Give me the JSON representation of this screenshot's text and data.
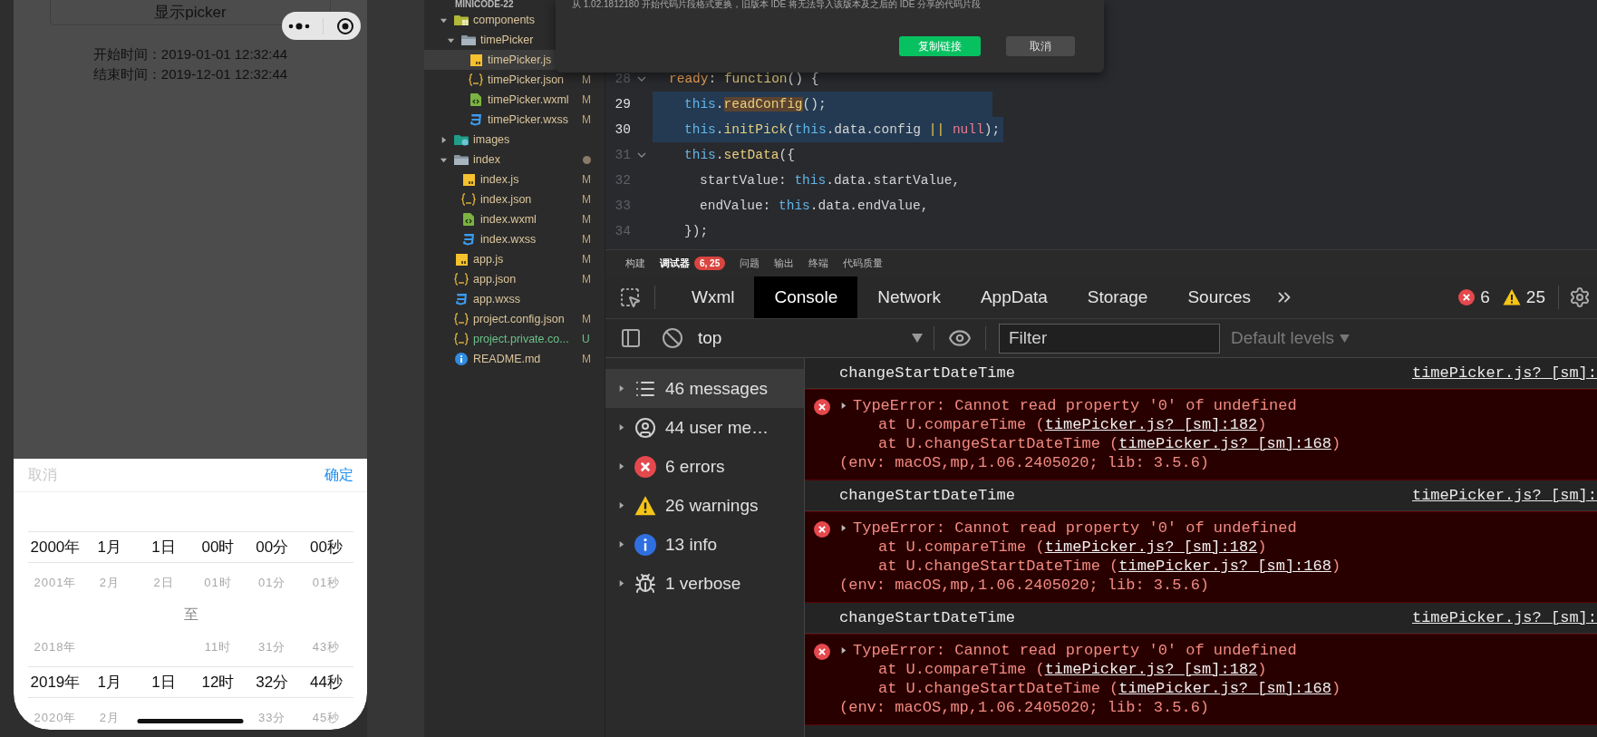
{
  "simulator": {
    "show_button": "显示picker",
    "times": [
      {
        "label": "开始时间：",
        "value": "2019-01-01 12:32:44"
      },
      {
        "label": "结束时间：",
        "value": "2019-12-01 12:32:44"
      }
    ],
    "picker": {
      "cancel": "取消",
      "confirm": "确定",
      "rows": [
        {
          "kind": "selected",
          "cells": [
            "2000年",
            "1月",
            "1日",
            "00时",
            "00分",
            "00秒"
          ]
        },
        {
          "kind": "dim",
          "cells": [
            "2001年",
            "2月",
            "2日",
            "01时",
            "01分",
            "01秒"
          ]
        },
        {
          "kind": "separator",
          "text": "至"
        },
        {
          "kind": "dim",
          "cells": [
            "2018年",
            null,
            null,
            "11时",
            "31分",
            "43秒"
          ]
        },
        {
          "kind": "selected",
          "cells": [
            "2019年",
            "1月",
            "1日",
            "12时",
            "32分",
            "44秒"
          ]
        },
        {
          "kind": "dim",
          "cells": [
            "2020年",
            "2月",
            null,
            null,
            "33分",
            "45秒"
          ]
        }
      ]
    }
  },
  "explorer": {
    "project": "MINICODE-22",
    "items": [
      {
        "name": "components",
        "kind": "folder-components",
        "expanded": true,
        "selected": false,
        "children": [
          {
            "name": "timePicker",
            "kind": "folder",
            "expanded": true,
            "selected": false,
            "children": [
              {
                "name": "timePicker.js",
                "kind": "js",
                "selected": true
              },
              {
                "name": "timePicker.json",
                "kind": "json",
                "status": "M",
                "selected": false
              },
              {
                "name": "timePicker.wxml",
                "kind": "wxml",
                "status": "M",
                "selected": false
              },
              {
                "name": "timePicker.wxss",
                "kind": "wxss",
                "status": "M",
                "selected": false
              }
            ]
          }
        ]
      },
      {
        "name": "images",
        "kind": "folder-images",
        "expanded": false,
        "selected": false
      },
      {
        "name": "index",
        "kind": "folder",
        "expanded": true,
        "selected": false,
        "dot": true,
        "children": [
          {
            "name": "index.js",
            "kind": "js",
            "status": "M",
            "selected": false
          },
          {
            "name": "index.json",
            "kind": "json",
            "status": "M",
            "selected": false
          },
          {
            "name": "index.wxml",
            "kind": "wxml",
            "status": "M",
            "selected": false
          },
          {
            "name": "index.wxss",
            "kind": "wxss",
            "status": "M",
            "selected": false
          }
        ]
      },
      {
        "name": "app.js",
        "kind": "js",
        "status": "M",
        "selected": false
      },
      {
        "name": "app.json",
        "kind": "json",
        "status": "M",
        "selected": false
      },
      {
        "name": "app.wxss",
        "kind": "wxss",
        "selected": false
      },
      {
        "name": "project.config.json",
        "kind": "json",
        "status": "M",
        "selected": false
      },
      {
        "name": "project.private.co...",
        "kind": "json",
        "status": "U",
        "selected": false
      },
      {
        "name": "README.md",
        "kind": "info",
        "status": "M",
        "selected": false
      }
    ]
  },
  "dialog": {
    "message": "从 1.02.1812180 开始代码片段格式更换，旧版本 IDE 将无法导入该版本及之后的 IDE 分享的代码片段",
    "buttons": [
      {
        "label": "复制链接",
        "kind": "primary"
      },
      {
        "label": "取消",
        "kind": "secondary"
      }
    ]
  },
  "editor": {
    "lines": [
      {
        "number": "28",
        "foldable": true,
        "highlighted": false,
        "tokens": [
          {
            "text": "ready",
            "kind": "key"
          },
          {
            "text": ": ",
            "kind": "punct"
          },
          {
            "text": "function",
            "kind": "fn"
          },
          {
            "text": "() {",
            "kind": "punct"
          }
        ],
        "children": [
          {
            "number": "29",
            "highlighted": true,
            "tokens": [
              {
                "text": "this",
                "kind": "kw"
              },
              {
                "text": ".",
                "kind": "punct"
              },
              {
                "text": "readConfig",
                "kind": "method",
                "match": true
              },
              {
                "text": "();",
                "kind": "punct"
              }
            ]
          },
          {
            "number": "30",
            "highlighted": true,
            "tokens": [
              {
                "text": "this",
                "kind": "kw"
              },
              {
                "text": ".",
                "kind": "punct"
              },
              {
                "text": "initPick",
                "kind": "method"
              },
              {
                "text": "(",
                "kind": "punct"
              },
              {
                "text": "this",
                "kind": "kw"
              },
              {
                "text": ".data.config ",
                "kind": "punct"
              },
              {
                "text": "|| ",
                "kind": "op"
              },
              {
                "text": "null",
                "kind": "null"
              },
              {
                "text": ");",
                "kind": "punct"
              }
            ]
          },
          {
            "number": "31",
            "foldable": true,
            "highlighted": false,
            "tokens": [
              {
                "text": "this",
                "kind": "kw"
              },
              {
                "text": ".",
                "kind": "punct"
              },
              {
                "text": "setData",
                "kind": "method"
              },
              {
                "text": "({",
                "kind": "punct"
              }
            ],
            "children": [
              {
                "number": "32",
                "highlighted": false,
                "tokens": [
                  {
                    "text": "startValue: ",
                    "kind": "punct"
                  },
                  {
                    "text": "this",
                    "kind": "kw"
                  },
                  {
                    "text": ".data.startValue,",
                    "kind": "punct"
                  }
                ]
              },
              {
                "number": "33",
                "highlighted": false,
                "tokens": [
                  {
                    "text": "endValue: ",
                    "kind": "punct"
                  },
                  {
                    "text": "this",
                    "kind": "kw"
                  },
                  {
                    "text": ".data.endValue,",
                    "kind": "punct"
                  }
                ]
              }
            ]
          },
          {
            "number": "34",
            "highlighted": false,
            "tokens": [
              {
                "text": "});",
                "kind": "punct"
              }
            ]
          }
        ]
      }
    ]
  },
  "panel_tabs": [
    {
      "label": "构建",
      "selected": false
    },
    {
      "label": "调试器",
      "selected": true,
      "badge": "6, 25"
    },
    {
      "label": "问题",
      "selected": false
    },
    {
      "label": "输出",
      "selected": false
    },
    {
      "label": "终端",
      "selected": false
    },
    {
      "label": "代码质量",
      "selected": false
    }
  ],
  "devtools": {
    "tabs": [
      {
        "label": "Wxml",
        "selected": false
      },
      {
        "label": "Console",
        "selected": true
      },
      {
        "label": "Network",
        "selected": false
      },
      {
        "label": "AppData",
        "selected": false
      },
      {
        "label": "Storage",
        "selected": false
      },
      {
        "label": "Sources",
        "selected": false
      }
    ],
    "error_count": "6",
    "warning_count": "25",
    "toolbar": {
      "context": "top",
      "filter_placeholder": "Filter",
      "levels": "Default levels"
    },
    "sidebar": [
      {
        "label": "46 messages",
        "kind": "messages",
        "selected": true
      },
      {
        "label": "44 user me…",
        "kind": "user",
        "selected": false
      },
      {
        "label": "6 errors",
        "kind": "error",
        "selected": false
      },
      {
        "label": "26 warnings",
        "kind": "warning",
        "selected": false
      },
      {
        "label": "13 info",
        "kind": "info",
        "selected": false
      },
      {
        "label": "1 verbose",
        "kind": "verbose",
        "selected": false
      }
    ],
    "messages": [
      {
        "kind": "log",
        "text": "changeStartDateTime",
        "source": "timePicker.js? [sm]:"
      },
      {
        "kind": "error",
        "message": "TypeError: Cannot read property '0' of undefined",
        "stack": [
          {
            "prefix": "at U.compareTime (",
            "link": "timePicker.js? [sm]:182",
            "suffix": ")"
          },
          {
            "prefix": "at U.changeStartDateTime (",
            "link": "timePicker.js? [sm]:168",
            "suffix": ")"
          }
        ],
        "env": "(env: macOS,mp,1.06.2405020; lib: 3.5.6)"
      },
      {
        "kind": "log",
        "text": "changeStartDateTime",
        "source": "timePicker.js? [sm]:"
      },
      {
        "kind": "error",
        "message": "TypeError: Cannot read property '0' of undefined",
        "stack": [
          {
            "prefix": "at U.compareTime (",
            "link": "timePicker.js? [sm]:182",
            "suffix": ")"
          },
          {
            "prefix": "at U.changeStartDateTime (",
            "link": "timePicker.js? [sm]:168",
            "suffix": ")"
          }
        ],
        "env": "(env: macOS,mp,1.06.2405020; lib: 3.5.6)"
      },
      {
        "kind": "log",
        "text": "changeStartDateTime",
        "source": "timePicker.js? [sm]:"
      },
      {
        "kind": "error",
        "message": "TypeError: Cannot read property '0' of undefined",
        "stack": [
          {
            "prefix": "at U.compareTime (",
            "link": "timePicker.js? [sm]:182",
            "suffix": ")"
          },
          {
            "prefix": "at U.changeStartDateTime (",
            "link": "timePicker.js? [sm]:168",
            "suffix": ")"
          }
        ],
        "env": "(env: macOS,mp,1.06.2405020; lib: 3.5.6)"
      }
    ]
  }
}
